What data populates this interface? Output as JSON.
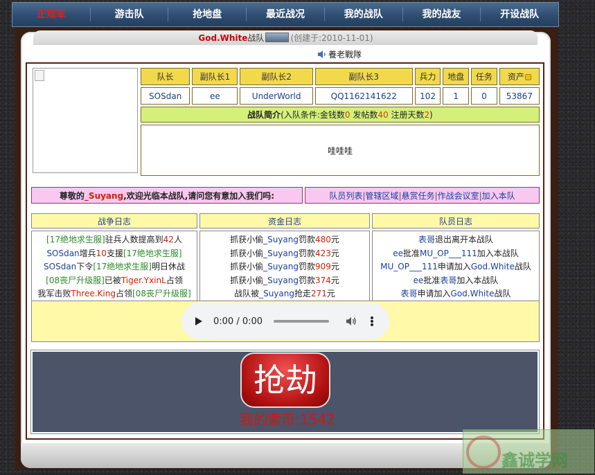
{
  "nav": {
    "items": [
      "正规军",
      "游击队",
      "抢地盘",
      "最近战况",
      "我的战队",
      "我的战友",
      "开设战队"
    ],
    "active_index": 0,
    "active_color": "#e02020"
  },
  "title": {
    "team_name": "God.White",
    "team_suffix": "战队",
    "created": "(创建于:2010-11-01)"
  },
  "motto": "養老戰隊",
  "info": {
    "headers": [
      "队长",
      "副队长1",
      "副队长2",
      "副队长3",
      "兵力",
      "地盘",
      "任务",
      "资产"
    ],
    "values": [
      "SOSdan",
      "ee",
      "UnderWorld",
      "QQ1162141622",
      "102",
      "1",
      "0",
      "53867"
    ]
  },
  "intro": {
    "label": "战队简介",
    "cond_prefix": "(入队条件:金钱数",
    "money": "0",
    "posts_label": " 发帖数",
    "posts": "40",
    "days_label": " 注册天数",
    "days": "2",
    "cond_suffix": ")",
    "body": "哇哇哇"
  },
  "welcome": {
    "prefix": "尊敬的",
    "username": "_Suyang",
    "suffix": ",欢迎光临本战队,请问您有意加入我们吗:",
    "links": [
      "队员列表",
      "管辖区域",
      "悬赏任务",
      "作战会议室",
      "加入本队"
    ]
  },
  "logs": {
    "headers": [
      "战争日志",
      "资金日志",
      "队员日志"
    ],
    "war": [
      [
        {
          "t": "[17绝地求生服]",
          "c": "c-green"
        },
        {
          "t": "驻兵人数提高到",
          "c": "c-dark"
        },
        {
          "t": "42",
          "c": "c-red"
        },
        {
          "t": "人",
          "c": "c-dark"
        }
      ],
      [
        {
          "t": "SOSdan",
          "c": "c-blue"
        },
        {
          "t": "增兵",
          "c": "c-dark"
        },
        {
          "t": "10",
          "c": "c-red"
        },
        {
          "t": "支援",
          "c": "c-dark"
        },
        {
          "t": "[17绝地求生服]",
          "c": "c-green"
        }
      ],
      [
        {
          "t": "SOSdan",
          "c": "c-blue"
        },
        {
          "t": "下令",
          "c": "c-dark"
        },
        {
          "t": "[17绝地求生服]",
          "c": "c-green"
        },
        {
          "t": "明日休战",
          "c": "c-dark"
        }
      ],
      [
        {
          "t": "[08丧尸升级服]",
          "c": "c-green"
        },
        {
          "t": "已被",
          "c": "c-dark"
        },
        {
          "t": "Tiger.YxinL",
          "c": "c-red"
        },
        {
          "t": "占领",
          "c": "c-dark"
        }
      ],
      [
        {
          "t": "我军击败",
          "c": "c-dark"
        },
        {
          "t": "Three.King",
          "c": "c-red"
        },
        {
          "t": "占领",
          "c": "c-dark"
        },
        {
          "t": "[08丧尸升级服]",
          "c": "c-green"
        }
      ]
    ],
    "money": [
      [
        {
          "t": "抓获小偷",
          "c": "c-dark"
        },
        {
          "t": "_Suyang",
          "c": "c-blue"
        },
        {
          "t": "罚款",
          "c": "c-dark"
        },
        {
          "t": "480",
          "c": "c-red"
        },
        {
          "t": "元",
          "c": "c-dark"
        }
      ],
      [
        {
          "t": "抓获小偷",
          "c": "c-dark"
        },
        {
          "t": "_Suyang",
          "c": "c-blue"
        },
        {
          "t": "罚款",
          "c": "c-dark"
        },
        {
          "t": "423",
          "c": "c-red"
        },
        {
          "t": "元",
          "c": "c-dark"
        }
      ],
      [
        {
          "t": "抓获小偷",
          "c": "c-dark"
        },
        {
          "t": "_Suyang",
          "c": "c-blue"
        },
        {
          "t": "罚款",
          "c": "c-dark"
        },
        {
          "t": "909",
          "c": "c-red"
        },
        {
          "t": "元",
          "c": "c-dark"
        }
      ],
      [
        {
          "t": "抓获小偷",
          "c": "c-dark"
        },
        {
          "t": "_Suyang",
          "c": "c-blue"
        },
        {
          "t": "罚款",
          "c": "c-dark"
        },
        {
          "t": "374",
          "c": "c-red"
        },
        {
          "t": "元",
          "c": "c-dark"
        }
      ],
      [
        {
          "t": "战队被",
          "c": "c-dark"
        },
        {
          "t": "_Suyang",
          "c": "c-blue"
        },
        {
          "t": "抢走",
          "c": "c-dark"
        },
        {
          "t": "271",
          "c": "c-red"
        },
        {
          "t": "元",
          "c": "c-dark"
        }
      ]
    ],
    "members": [
      [
        {
          "t": "表哥",
          "c": "c-blue"
        },
        {
          "t": "退出离开本战队",
          "c": "c-dark"
        }
      ],
      [
        {
          "t": "ee",
          "c": "c-blue"
        },
        {
          "t": "批准",
          "c": "c-dark"
        },
        {
          "t": "MU_OP___111",
          "c": "c-blue"
        },
        {
          "t": "加入本战队",
          "c": "c-dark"
        }
      ],
      [
        {
          "t": "MU_OP___111",
          "c": "c-blue"
        },
        {
          "t": "申请加入",
          "c": "c-dark"
        },
        {
          "t": "God.White",
          "c": "c-blue"
        },
        {
          "t": "战队",
          "c": "c-dark"
        }
      ],
      [
        {
          "t": "ee",
          "c": "c-blue"
        },
        {
          "t": "批准",
          "c": "c-dark"
        },
        {
          "t": "表哥",
          "c": "c-blue"
        },
        {
          "t": "加入本战队",
          "c": "c-dark"
        }
      ],
      [
        {
          "t": "表哥",
          "c": "c-blue"
        },
        {
          "t": "申请加入",
          "c": "c-dark"
        },
        {
          "t": "God.White",
          "c": "c-blue"
        },
        {
          "t": "战队",
          "c": "c-dark"
        }
      ]
    ]
  },
  "audio": {
    "time": "0:00 / 0:00",
    "progress": 0
  },
  "rob": {
    "button_label": "抢劫",
    "coins_label": "我的索币:1542"
  },
  "watermark": {
    "text": "鑫诚学网"
  },
  "colors": {
    "nav_bg": "#2f4d70",
    "header_yellow": "#f2d94c",
    "intro_green": "#d4f07a",
    "welcome_pink": "#f8c8f0",
    "log_head": "#fff9a8",
    "rob_bg": "#4b5468",
    "rob_button": "#c01818"
  },
  "icons": [
    "speaker-icon",
    "coin-icon",
    "play-icon",
    "volume-icon",
    "more-options-icon",
    "broken-image-icon",
    "team-flag-icon"
  ]
}
